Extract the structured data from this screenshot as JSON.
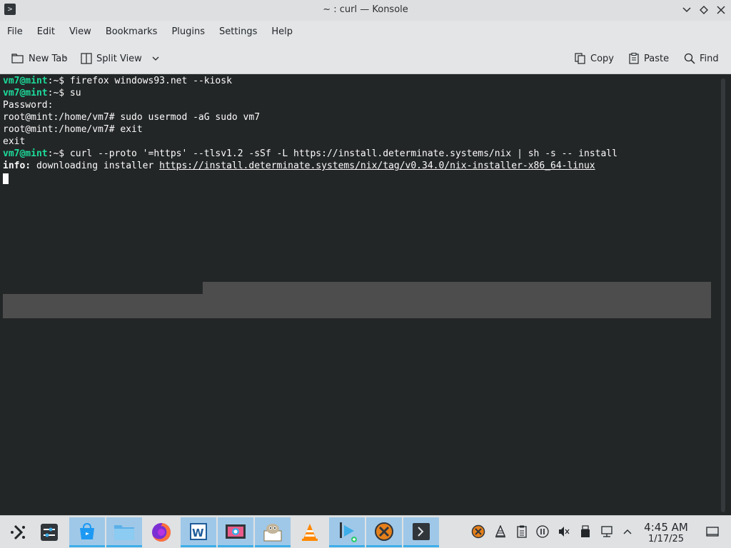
{
  "window": {
    "title": "~ : curl — Konsole",
    "app_icon_glyph": ">"
  },
  "menubar": {
    "items": [
      "File",
      "Edit",
      "View",
      "Bookmarks",
      "Plugins",
      "Settings",
      "Help"
    ]
  },
  "toolbar": {
    "new_tab": "New Tab",
    "split_view": "Split View",
    "copy": "Copy",
    "paste": "Paste",
    "find": "Find"
  },
  "terminal": {
    "lines": [
      {
        "user": "vm7@mint",
        "path": ":~$",
        "cmd": " firefox windows93.net --kiosk"
      },
      {
        "user": "vm7@mint",
        "path": ":~$",
        "cmd": " su"
      },
      {
        "text": "Password:"
      },
      {
        "text": "root@mint:/home/vm7# sudo usermod -aG sudo vm7"
      },
      {
        "text": "root@mint:/home/vm7# exit"
      },
      {
        "text": "exit"
      },
      {
        "user": "vm7@mint",
        "path": ":~$",
        "cmd": " curl --proto '=https' --tlsv1.2 -sSf -L https://install.determinate.systems/nix | sh -s -- install"
      },
      {
        "info_label": "info:",
        "info_text": " downloading installer ",
        "link": "https://install.determinate.systems/nix/tag/v0.34.0/nix-installer-x86_64-linux"
      }
    ]
  },
  "taskbar": {
    "apps": [
      "app-launcher",
      "system-settings",
      "discover-store",
      "file-manager",
      "firefox",
      "libreoffice-writer",
      "screenshot-tool",
      "gimp",
      "vlc",
      "kdenlive",
      "close-app",
      "konsole"
    ],
    "clock_time": "4:45 AM",
    "clock_date": "1/17/25"
  },
  "colors": {
    "terminal_bg": "#232627",
    "prompt_user": "#1cdc9a",
    "chrome_bg": "#e3e5e7",
    "taskbar_active": "#3daee9"
  }
}
